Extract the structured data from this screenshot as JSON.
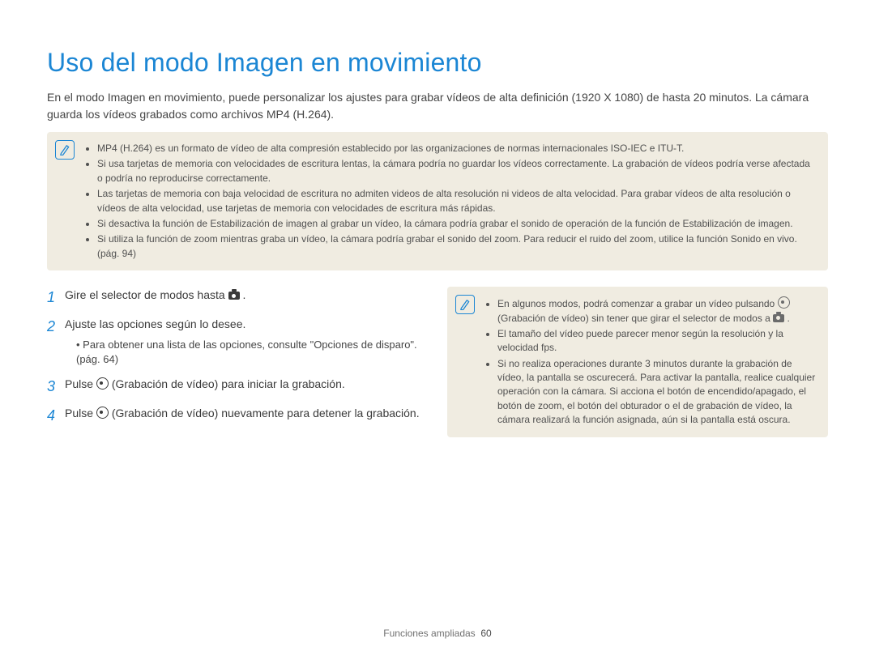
{
  "title": "Uso del modo Imagen en movimiento",
  "intro": "En el modo Imagen en movimiento, puede personalizar los ajustes para grabar vídeos de alta definición (1920 X 1080) de hasta 20 minutos. La cámara guarda los vídeos grabados como archivos MP4 (H.264).",
  "topNotes": [
    "MP4 (H.264) es un formato de vídeo de alta compresión establecido por las organizaciones de normas internacionales ISO-IEC e ITU-T.",
    "Si usa tarjetas de memoria con velocidades de escritura lentas, la cámara podría no guardar los vídeos correctamente. La grabación de vídeos podría verse afectada o podría no reproducirse correctamente.",
    "Las tarjetas de memoria con baja velocidad de escritura no admiten videos de alta resolución ni videos de alta velocidad. Para grabar vídeos de alta resolución o vídeos de alta velocidad, use tarjetas de memoria con velocidades de escritura más rápidas.",
    "Si desactiva la función de Estabilización de imagen al grabar un vídeo, la cámara podría grabar el sonido de operación de la función de Estabilización de imagen.",
    "Si utiliza la función de zoom mientras graba un vídeo, la cámara podría grabar el sonido del zoom. Para reducir el ruido del zoom, utilice la función Sonido en vivo. (pág. 94)"
  ],
  "steps": {
    "s1": {
      "num": "1",
      "pre": "Gire el selector de modos hasta ",
      "post": "."
    },
    "s2": {
      "num": "2",
      "text": "Ajuste las opciones según lo desee.",
      "sub": "Para obtener una lista de las opciones, consulte \"Opciones de disparo\". (pág. 64)"
    },
    "s3": {
      "num": "3",
      "pre": "Pulse ",
      "post": " (Grabación de vídeo) para iniciar la grabación."
    },
    "s4": {
      "num": "4",
      "pre": "Pulse ",
      "post": " (Grabación de vídeo) nuevamente para detener la grabación."
    }
  },
  "rightNotes": {
    "n1": {
      "pre": "En algunos modos, podrá comenzar a grabar un vídeo pulsando ",
      "mid": " (Grabación de vídeo) sin tener que girar el selector de modos a ",
      "post": "."
    },
    "n2": "El tamaño del vídeo puede parecer menor según la resolución y la velocidad fps.",
    "n3": "Si no realiza operaciones durante 3 minutos durante la grabación de vídeo, la pantalla se oscurecerá. Para activar la pantalla, realice cualquier operación con la cámara. Si acciona el botón de encendido/apagado, el botón de zoom, el botón del obturador o el de grabación de vídeo, la cámara realizará la función asignada, aún si la pantalla está oscura."
  },
  "footer": {
    "section": "Funciones ampliadas",
    "page": "60"
  }
}
